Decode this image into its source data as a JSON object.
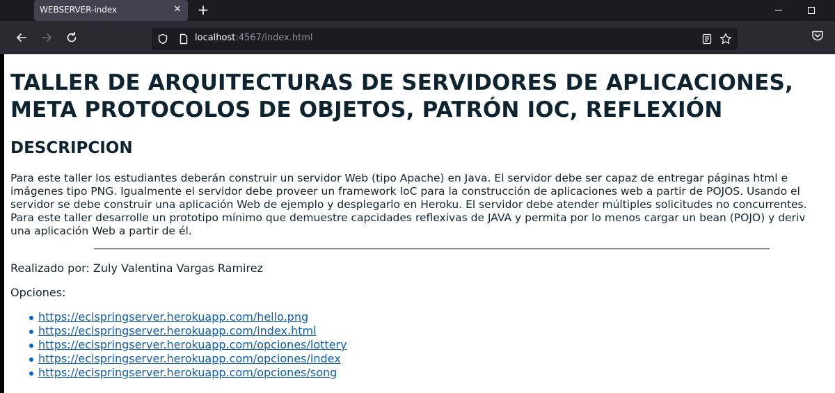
{
  "browser": {
    "tab_title": "WEBSERVER-index",
    "url_host": "localhost",
    "url_rest": ":4567/index.html"
  },
  "page": {
    "title_line1": "TALLER DE ARQUITECTURAS DE SERVIDORES DE APLICACIONES,",
    "title_line2": "META PROTOCOLOS DE OBJETOS, PATRÓN IOC, REFLEXIÓN",
    "section_heading": "DESCRIPCION",
    "description_lines": [
      "Para este taller los estudiantes deberán construir un servidor Web (tipo Apache) en Java. El servidor debe ser capaz de entregar páginas html e",
      "imágenes tipo PNG. Igualmente el servidor debe proveer un framework IoC para la construcción de aplicaciones web a partir de POJOS. Usando el",
      "servidor se debe construir una aplicación Web de ejemplo y desplegarlo en Heroku. El servidor debe atender múltiples solicitudes no concurrentes.",
      "Para este taller desarrolle un prototipo mínimo que demuestre capcidades reflexivas de JAVA y permita por lo menos cargar un bean (POJO) y deriv",
      "una aplicación Web a partir de él."
    ],
    "author_text": "Realizado por: Zuly Valentina Vargas Ramirez",
    "options_label": "Opciones:",
    "links": [
      "https://ecispringserver.herokuapp.com/hello.png",
      "https://ecispringserver.herokuapp.com/index.html",
      "https://ecispringserver.herokuapp.com/opciones/lottery",
      "https://ecispringserver.herokuapp.com/opciones/index",
      "https://ecispringserver.herokuapp.com/opciones/song"
    ]
  }
}
